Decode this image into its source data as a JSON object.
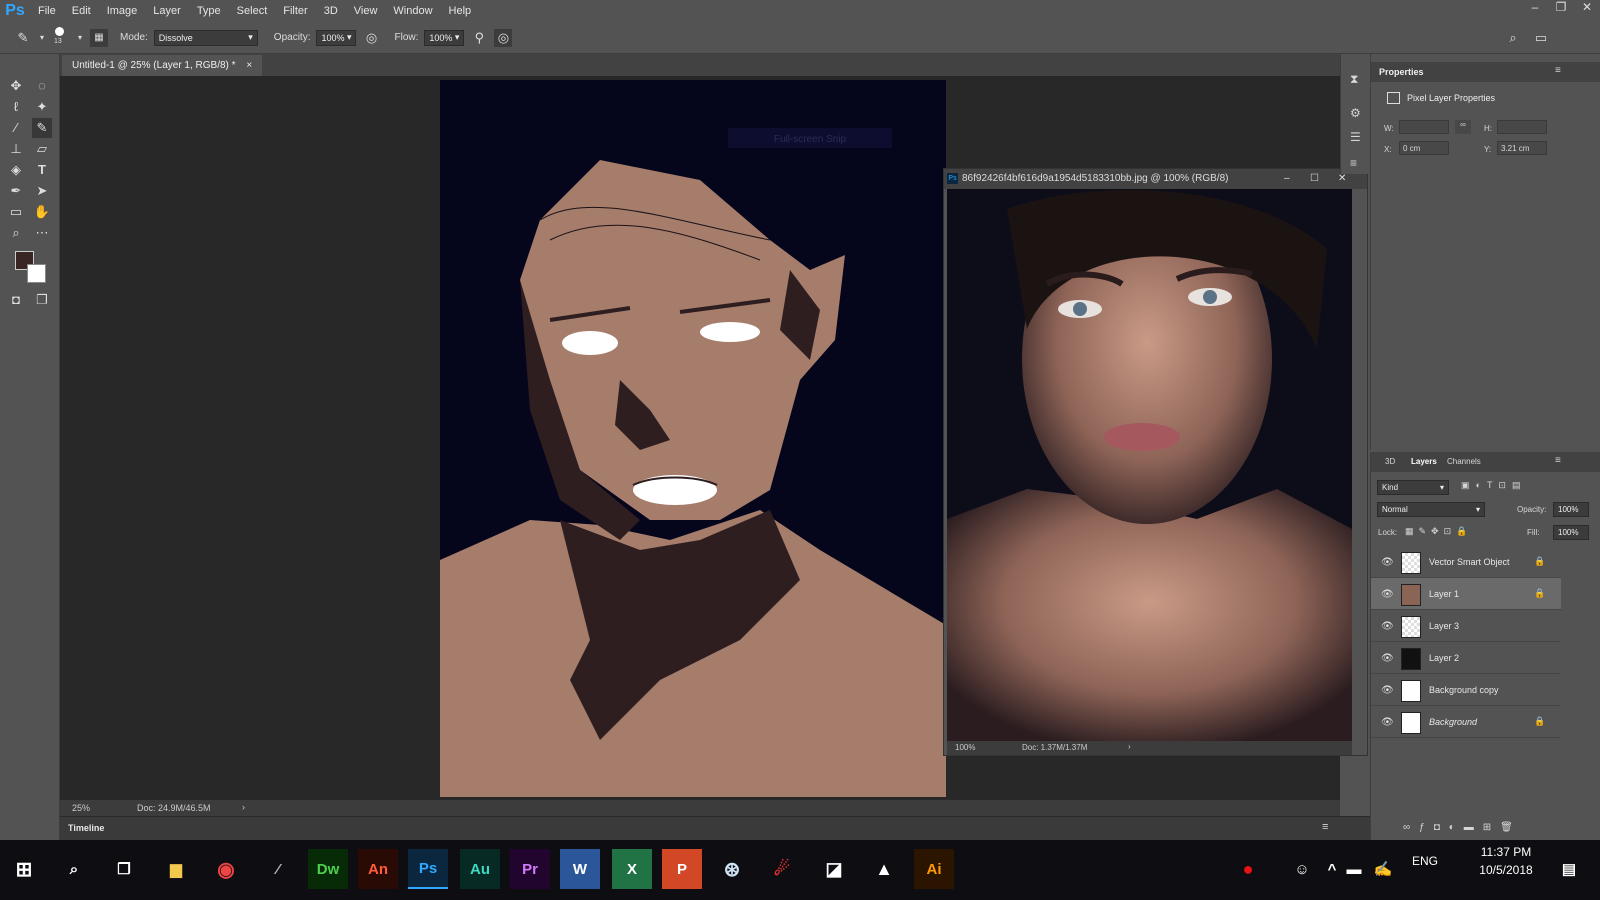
{
  "app": {
    "logo": "Ps"
  },
  "menu": [
    "File",
    "Edit",
    "Image",
    "Layer",
    "Type",
    "Select",
    "Filter",
    "3D",
    "View",
    "Window",
    "Help"
  ],
  "options": {
    "brush_size": "13",
    "mode_label": "Mode:",
    "mode_value": "Dissolve",
    "opacity_label": "Opacity:",
    "opacity_value": "100%",
    "flow_label": "Flow:",
    "flow_value": "100%"
  },
  "document": {
    "tab_title": "Untitled-1 @ 25% (Layer 1, RGB/8) *",
    "zoom": "25%",
    "doc_size": "Doc: 24.9M/46.5M",
    "overlay_text": "Full-screen Snip"
  },
  "float_window": {
    "title": "86f92426f4bf616d9a1954d5183310bb.jpg @ 100% (RGB/8)",
    "zoom": "100%",
    "doc_size": "Doc: 1.37M/1.37M"
  },
  "timeline_label": "Timeline",
  "properties": {
    "tab": "Properties",
    "section": "Pixel Layer Properties",
    "w_label": "W:",
    "h_label": "H:",
    "x_label": "X:",
    "x_value": "0 cm",
    "y_label": "Y:",
    "y_value": "3.21 cm"
  },
  "layers_panel": {
    "tabs": [
      "3D",
      "Layers",
      "Channels"
    ],
    "filter": "Kind",
    "blend": "Normal",
    "opacity_label": "Opacity:",
    "opacity_value": "100%",
    "lock_label": "Lock:",
    "fill_label": "Fill:",
    "fill_value": "100%",
    "layers": [
      {
        "name": "Vector Smart Object",
        "locked": true
      },
      {
        "name": "Layer 1",
        "locked": true,
        "selected": true
      },
      {
        "name": "Layer 3",
        "locked": false
      },
      {
        "name": "Layer 2",
        "locked": false
      },
      {
        "name": "Background copy",
        "locked": false
      },
      {
        "name": "Background",
        "locked": true
      }
    ]
  },
  "taskbar": {
    "time": "11:37 PM",
    "date": "10/5/2018",
    "lang": "ENG",
    "apps": [
      "Dw",
      "An",
      "Ps",
      "Au",
      "Pr",
      "Ai"
    ]
  },
  "colors": {
    "accent": "#31a8ff",
    "canvas_bg": "#282828",
    "panel_bg": "#535353"
  }
}
